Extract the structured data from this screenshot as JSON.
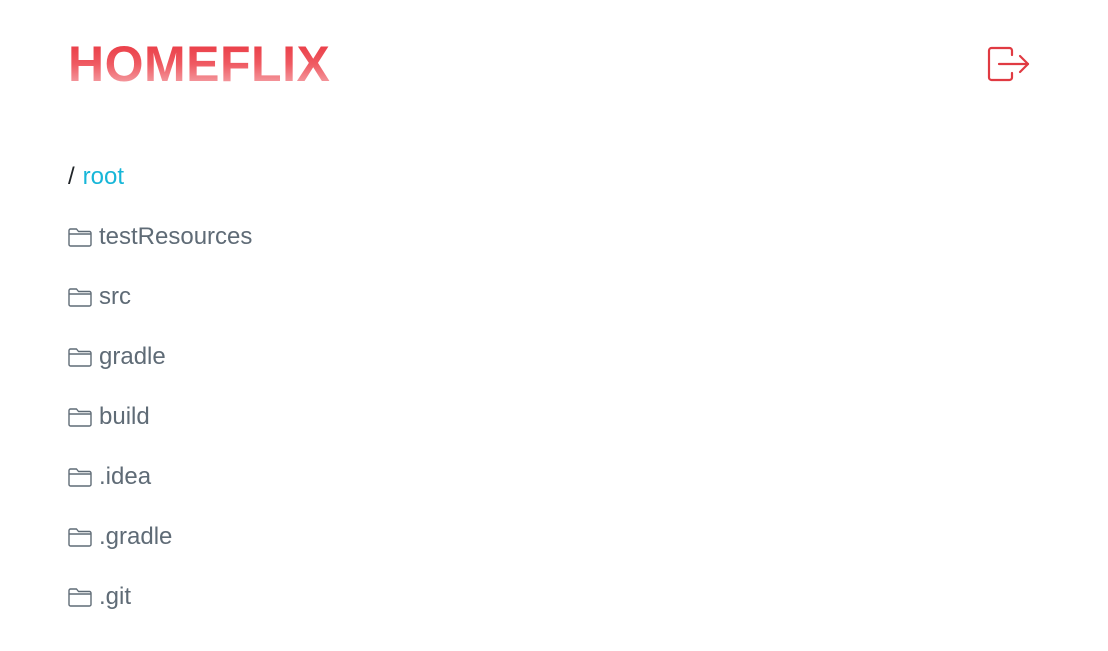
{
  "header": {
    "logo_text": "HOMEFLIX",
    "logout_icon": "box-arrow-right-icon"
  },
  "colors": {
    "brand_red": "#e8323c",
    "link_cyan": "#17b6d8",
    "folder_text": "#5f6b76"
  },
  "breadcrumb": {
    "separator": "/",
    "items": [
      {
        "label": "root"
      }
    ]
  },
  "folders": [
    {
      "name": "testResources",
      "icon": "folder-icon"
    },
    {
      "name": "src",
      "icon": "folder-icon"
    },
    {
      "name": "gradle",
      "icon": "folder-icon"
    },
    {
      "name": "build",
      "icon": "folder-icon"
    },
    {
      "name": ".idea",
      "icon": "folder-icon"
    },
    {
      "name": ".gradle",
      "icon": "folder-icon"
    },
    {
      "name": ".git",
      "icon": "folder-icon"
    }
  ]
}
